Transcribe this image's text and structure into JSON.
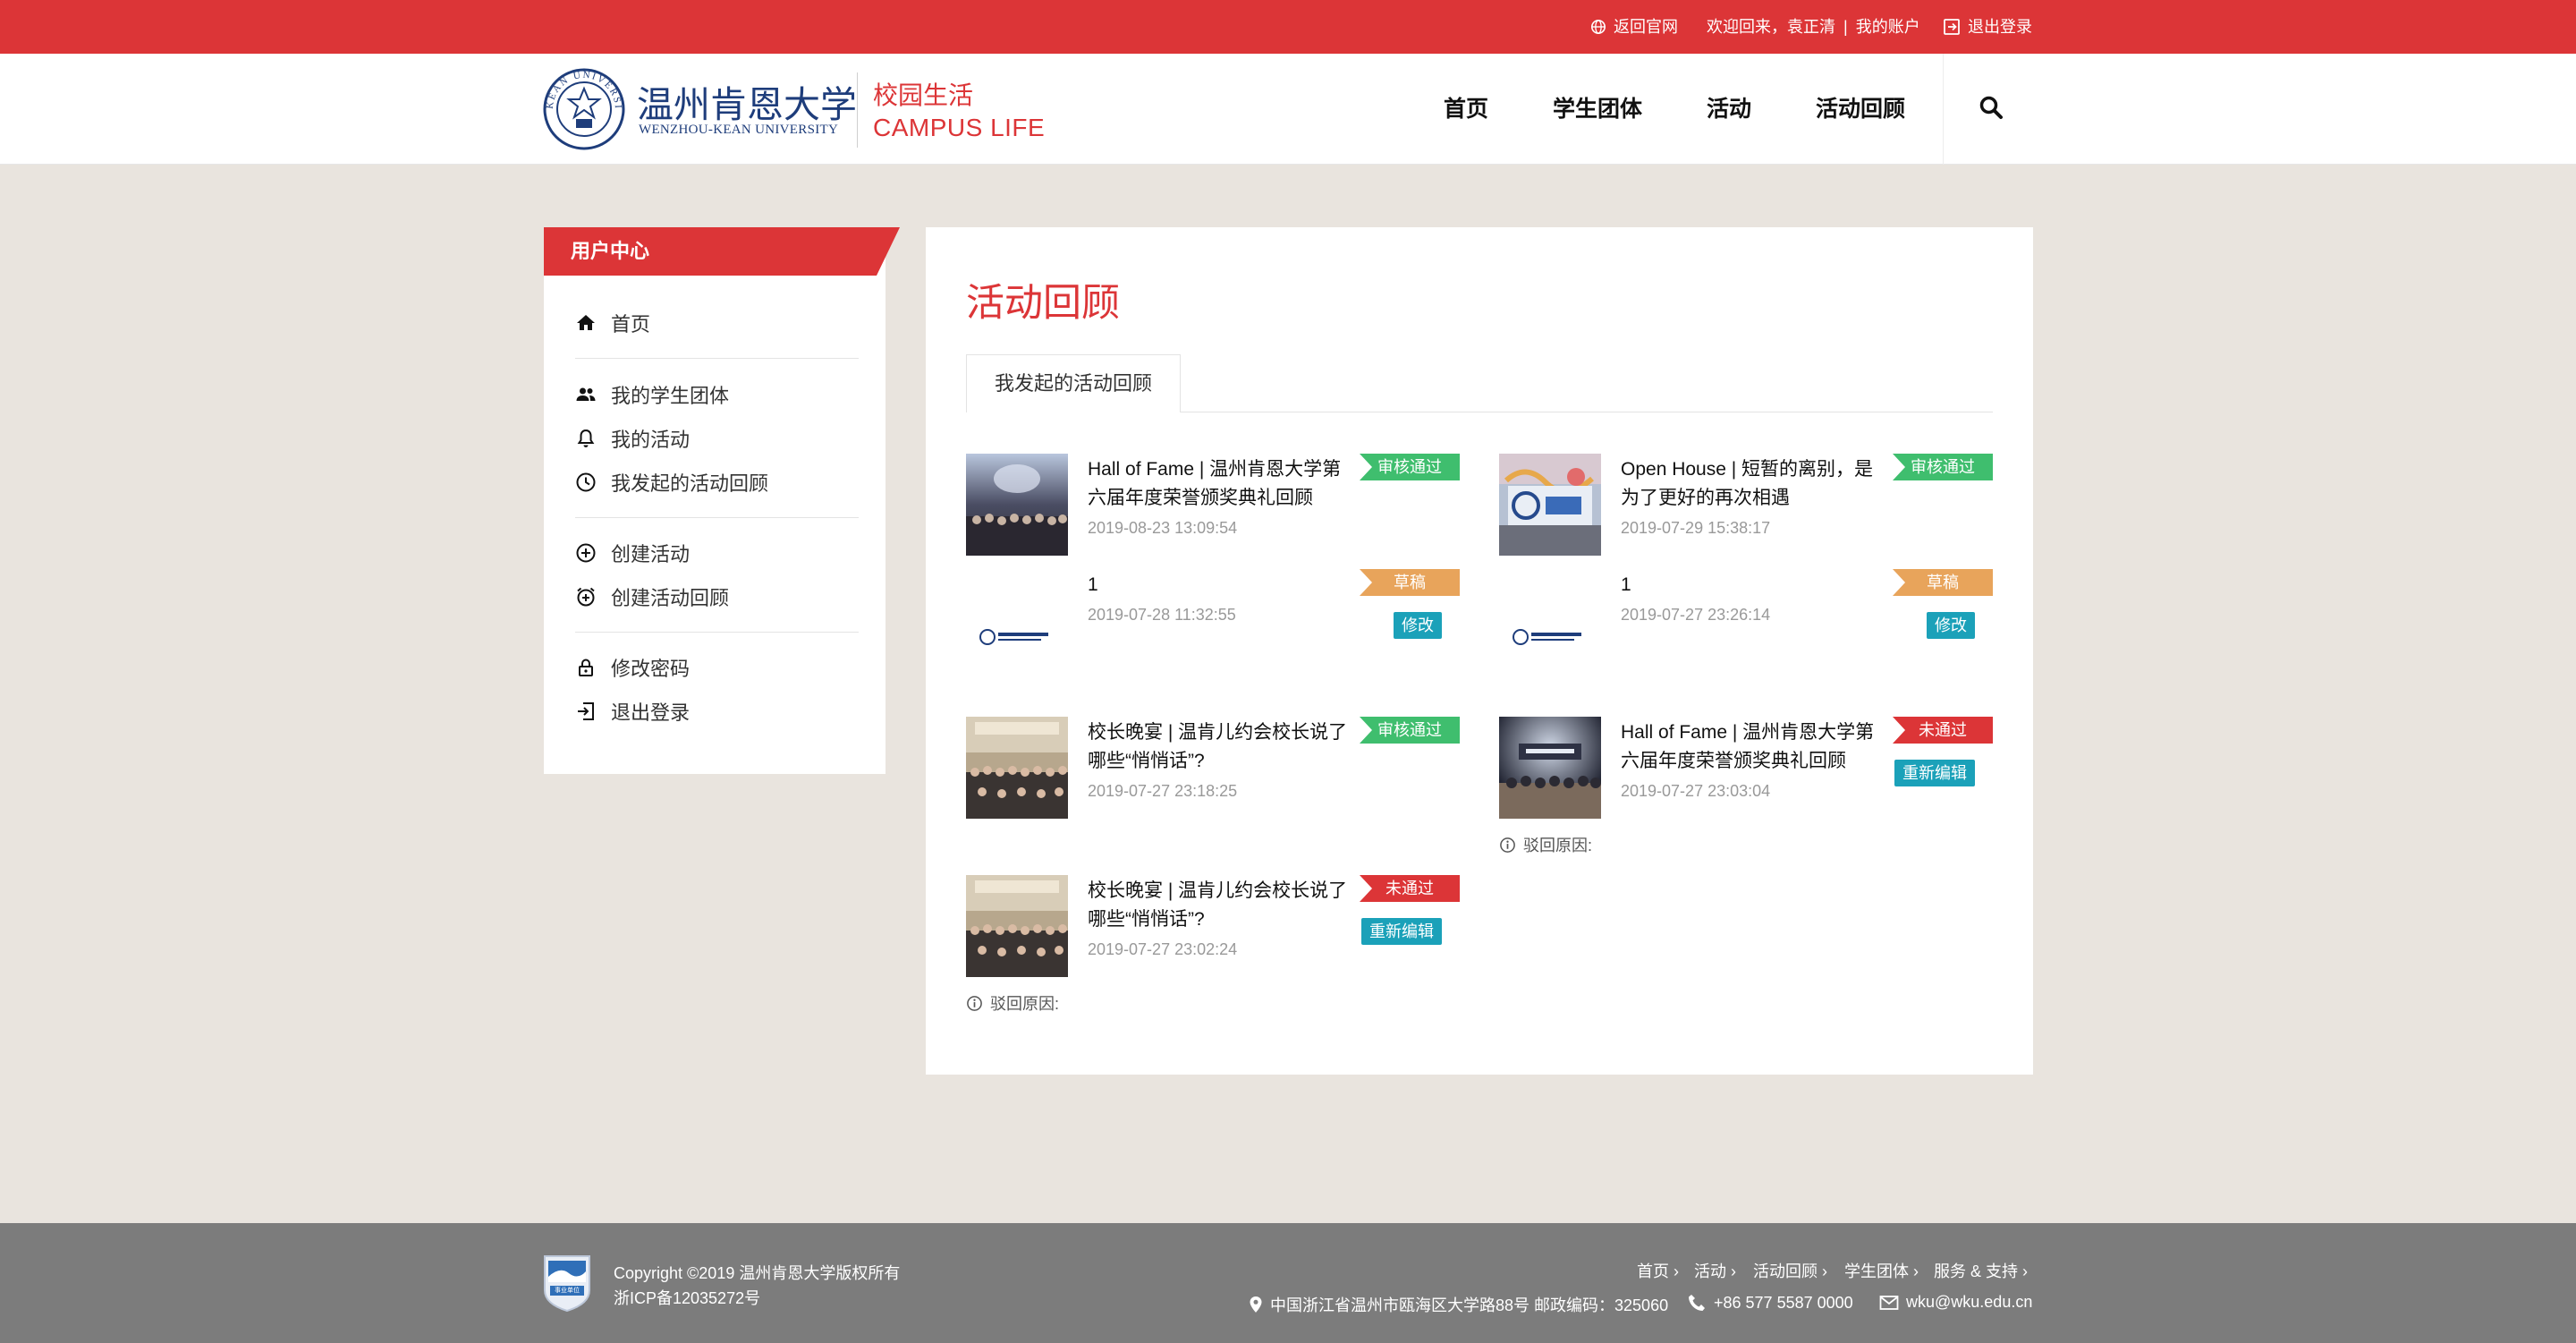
{
  "topbar": {
    "home_link": "返回官网",
    "welcome": "欢迎回来，",
    "username": "袁正清",
    "separator": "|",
    "account": "我的账户",
    "logout": "退出登录"
  },
  "brand": {
    "seal_outer": "KEAN UNIVERSITY",
    "name_cn": "温州肯恩大学",
    "name_en": "WENZHOU-KEAN UNIVERSITY",
    "section_cn": "校园生活",
    "section_en": "CAMPUS LIFE"
  },
  "nav": {
    "items": [
      "首页",
      "学生团体",
      "活动",
      "活动回顾"
    ]
  },
  "sidebar": {
    "title": "用户中心",
    "items": [
      "首页",
      "我的学生团体",
      "我的活动",
      "我发起的活动回顾",
      "创建活动",
      "创建活动回顾",
      "修改密码",
      "退出登录"
    ]
  },
  "main": {
    "title": "活动回顾",
    "tab": "我发起的活动回顾",
    "reason_label": "驳回原因:",
    "cards": [
      {
        "title": "Hall of Fame | 温州肯恩大学第六届年度荣誉颁奖典礼回顾",
        "date": "2019-08-23 13:09:54",
        "status": "审核通过"
      },
      {
        "title": "Open House | 短暂的离别，是为了更好的再次相遇",
        "date": "2019-07-29 15:38:17",
        "status": "审核通过"
      },
      {
        "title": "1",
        "date": "2019-07-28 11:32:55",
        "status": "草稿",
        "action": "修改"
      },
      {
        "title": "1",
        "date": "2019-07-27 23:26:14",
        "status": "草稿",
        "action": "修改"
      },
      {
        "title": "校长晚宴 | 温肯儿约会校长说了哪些“悄悄话”?",
        "date": "2019-07-27 23:18:25",
        "status": "审核通过"
      },
      {
        "title": "Hall of Fame | 温州肯恩大学第六届年度荣誉颁奖典礼回顾",
        "date": "2019-07-27 23:03:04",
        "status": "未通过",
        "action": "重新编辑"
      },
      {
        "title": "校长晚宴 | 温肯儿约会校长说了哪些“悄悄话”?",
        "date": "2019-07-27 23:02:24",
        "status": "未通过",
        "action": "重新编辑"
      }
    ]
  },
  "footer": {
    "copyright": "Copyright ©2019 温州肯恩大学版权所有",
    "icp": "浙ICP备12035272号",
    "badge": "事业单位",
    "links": [
      "首页",
      "活动",
      "活动回顾",
      "学生团体",
      "服务 & 支持"
    ],
    "address": "中国浙江省温州市瓯海区大学路88号 邮政编码：325060",
    "phone": "+86 577 5587 0000",
    "email": "wku@wku.edu.cn"
  },
  "colors": {
    "accent": "#dc3537",
    "approved": "#3fbe6e",
    "draft": "#e8a45b",
    "rejected": "#dc3537",
    "button": "#1ba1b9",
    "brand_blue": "#1e3d7b"
  }
}
